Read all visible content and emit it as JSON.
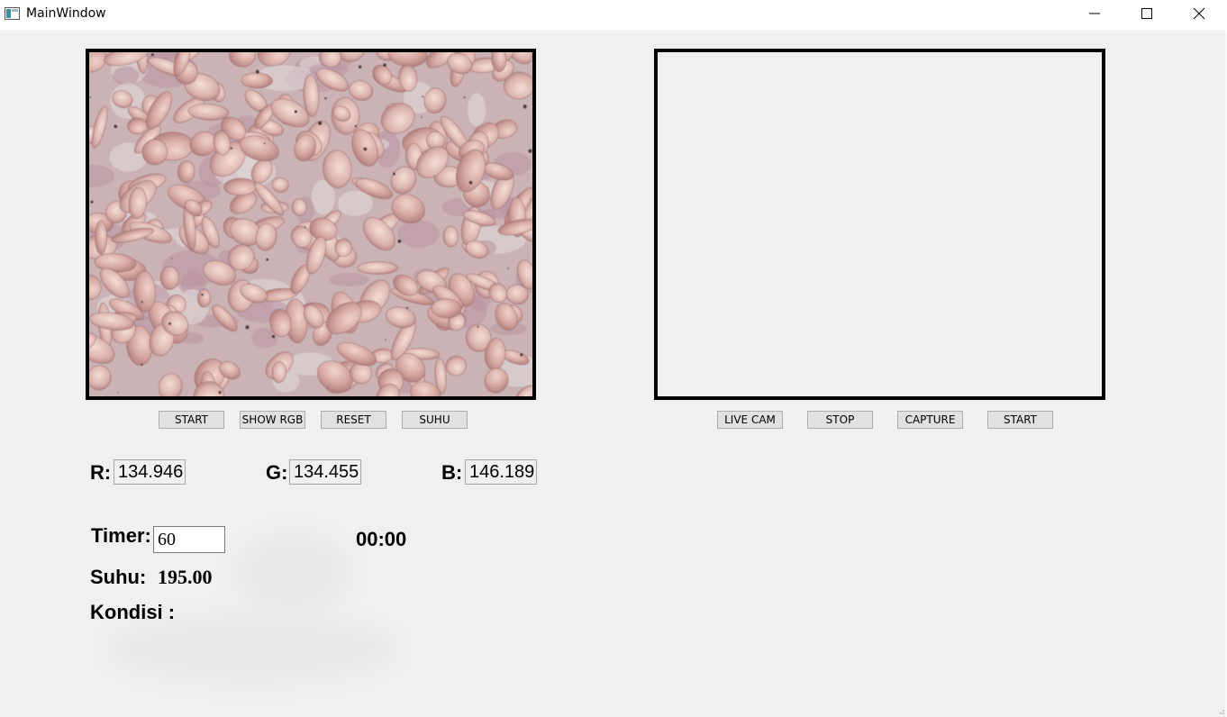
{
  "window": {
    "title": "MainWindow",
    "minimize_icon": "minimize-icon",
    "maximize_icon": "maximize-icon",
    "close_icon": "close-icon"
  },
  "left_panel": {
    "image": "captured-tempeh-image",
    "buttons": [
      "START",
      "SHOW RGB",
      "RESET",
      "SUHU"
    ]
  },
  "right_panel": {
    "image": "live-camera-view",
    "buttons": [
      "LIVE CAM",
      "STOP",
      "CAPTURE",
      "START"
    ]
  },
  "rgb": {
    "r_label": "R:",
    "r_value": "134.946",
    "g_label": "G:",
    "g_value": "134.455",
    "b_label": "B:",
    "b_value": "146.189"
  },
  "timer": {
    "label": "Timer:",
    "input_value": "60",
    "clock": "00:00"
  },
  "suhu": {
    "label": "Suhu:",
    "value": "195.00"
  },
  "kondisi": {
    "label": "Kondisi :",
    "value": ""
  }
}
